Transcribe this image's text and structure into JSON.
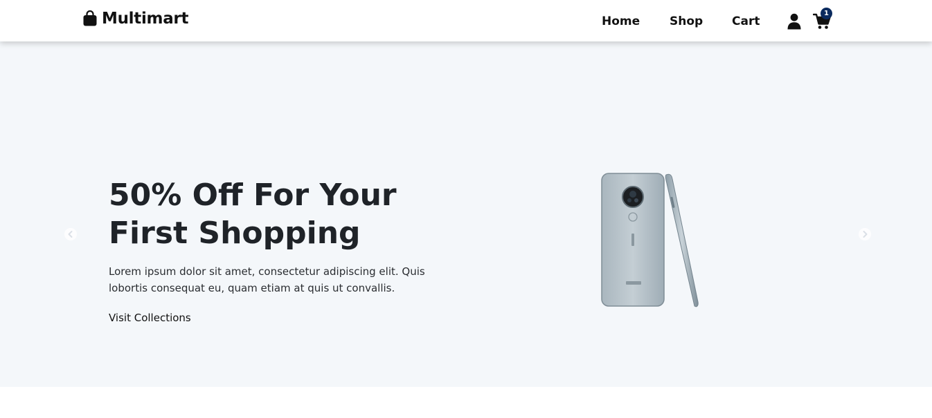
{
  "brand": {
    "name": "Multimart",
    "icon": "shopping-bag-icon"
  },
  "nav": {
    "items": [
      {
        "label": "Home"
      },
      {
        "label": "Shop"
      },
      {
        "label": "Cart"
      }
    ],
    "user_icon": "user-icon",
    "cart_icon": "shopping-cart-icon",
    "cart_count": "1"
  },
  "hero": {
    "title": "50% Off For Your First Shopping",
    "description": "Lorem ipsum dolor sit amet, consectetur adipiscing elit. Quis lobortis consequat eu, quam etiam at quis ut convallis.",
    "cta_label": "Visit Collections",
    "prev_icon": "chevron-left-icon",
    "next_icon": "chevron-right-icon"
  },
  "colors": {
    "hero_background": "#f4f7fa",
    "badge_background": "#0a2a5e",
    "text_primary": "#1f2328"
  }
}
